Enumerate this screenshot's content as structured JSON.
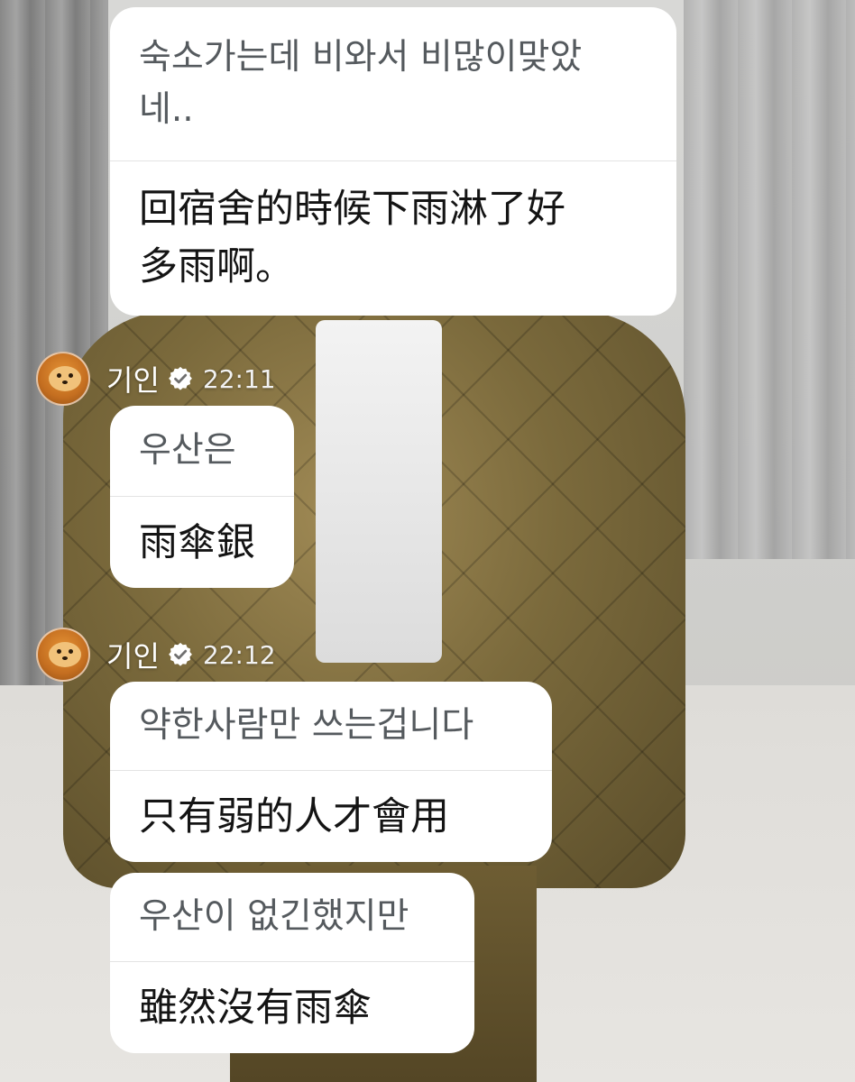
{
  "messages": [
    {
      "original": "숙소가는데 비와서 비많이맞았네..",
      "original_line1": "숙소가는데 비와서 비많이맞았",
      "original_line2": "네..",
      "translation": "回宿舍的時候下雨淋了好多雨啊。",
      "translation_line1": "回宿舍的時候下雨淋了好",
      "translation_line2": "多雨啊。"
    },
    {
      "sender": "기인",
      "time": "22:11",
      "original": "우산은",
      "translation": "雨傘銀"
    },
    {
      "sender": "기인",
      "time": "22:12",
      "original": "약한사람만 쓰는겁니다",
      "translation": "只有弱的人才會用"
    },
    {
      "original": "우산이 없긴했지만",
      "translation": "雖然沒有雨傘"
    }
  ],
  "icons": {
    "avatar": "tiger-avatar",
    "verified": "verified-check-icon"
  },
  "colors": {
    "bubble_bg": "#ffffff",
    "original_text": "#555a5e",
    "translation_text": "#141414",
    "verified_badge": "#ffffff"
  }
}
